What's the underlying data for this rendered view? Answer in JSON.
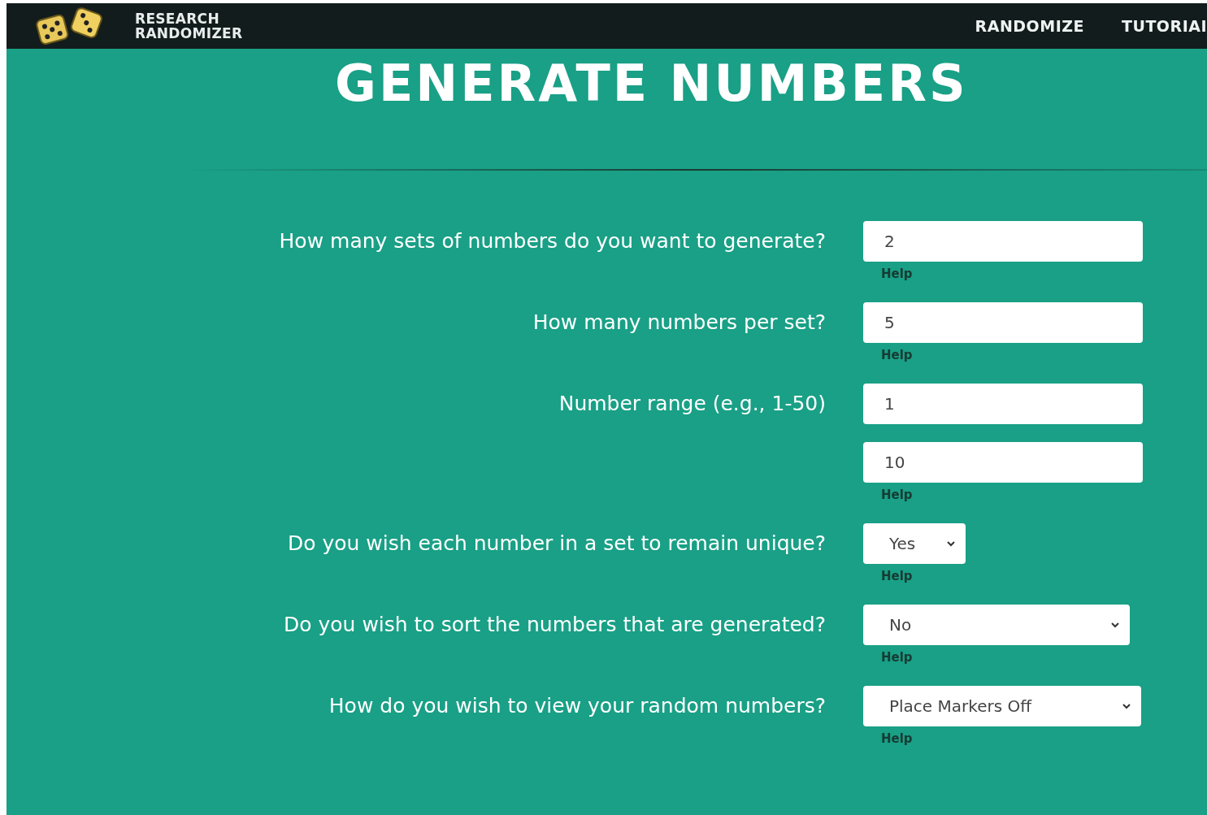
{
  "header": {
    "brand": [
      "RESEARCH",
      "RANDOMIZER"
    ],
    "nav": [
      {
        "label": "RANDOMIZE"
      },
      {
        "label": "TUTORIAI"
      }
    ]
  },
  "title": "GENERATE NUMBERS",
  "questions": [
    {
      "label": "How many sets of numbers do you want to generate?",
      "kind": "input",
      "values": [
        "2"
      ],
      "help": "Help"
    },
    {
      "label": "How many numbers per set?",
      "kind": "input",
      "values": [
        "5"
      ],
      "help": "Help"
    },
    {
      "label": "Number range (e.g., 1-50)",
      "kind": "input",
      "values": [
        "1",
        "10"
      ],
      "help": "Help"
    },
    {
      "label": "Do you wish each number in a set to remain unique?",
      "kind": "select",
      "values": [
        "Yes"
      ],
      "help": "Help"
    },
    {
      "label": "Do you wish to sort the numbers that are generated?",
      "kind": "select",
      "values": [
        "No"
      ],
      "help": "Help"
    },
    {
      "label": "How do you wish to view your random numbers?",
      "kind": "select",
      "values": [
        "Place Markers Off"
      ],
      "help": "Help"
    }
  ]
}
